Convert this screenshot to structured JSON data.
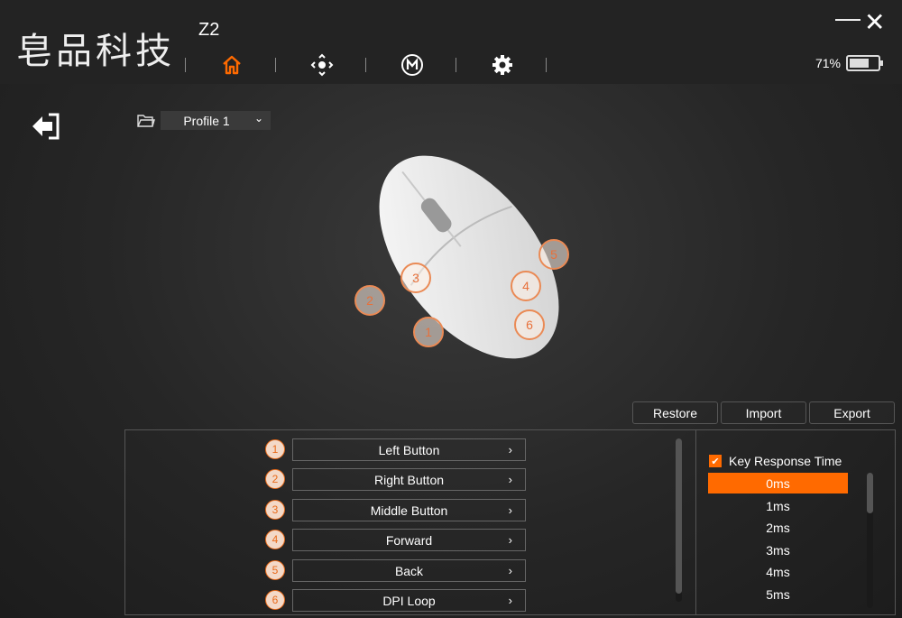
{
  "header": {
    "logo": "皂品科技",
    "model": "Z2",
    "battery": "71%",
    "battery_level": 0.71,
    "accent": "#ff6a00"
  },
  "nav": [
    "home-icon",
    "dpi-icon",
    "macro-icon",
    "settings-icon"
  ],
  "profile": {
    "selected": "Profile 1"
  },
  "toolbar": {
    "restore": "Restore",
    "import": "Import",
    "export": "Export"
  },
  "buttons": [
    {
      "num": "1",
      "label": "Left Button"
    },
    {
      "num": "2",
      "label": "Right Button"
    },
    {
      "num": "3",
      "label": "Middle Button"
    },
    {
      "num": "4",
      "label": "Forward"
    },
    {
      "num": "5",
      "label": "Back"
    },
    {
      "num": "6",
      "label": "DPI Loop"
    }
  ],
  "response": {
    "label": "Key Response Time",
    "checked": true,
    "options": [
      "0ms",
      "1ms",
      "2ms",
      "3ms",
      "4ms",
      "5ms"
    ],
    "selected": "0ms"
  },
  "arrow": "›"
}
